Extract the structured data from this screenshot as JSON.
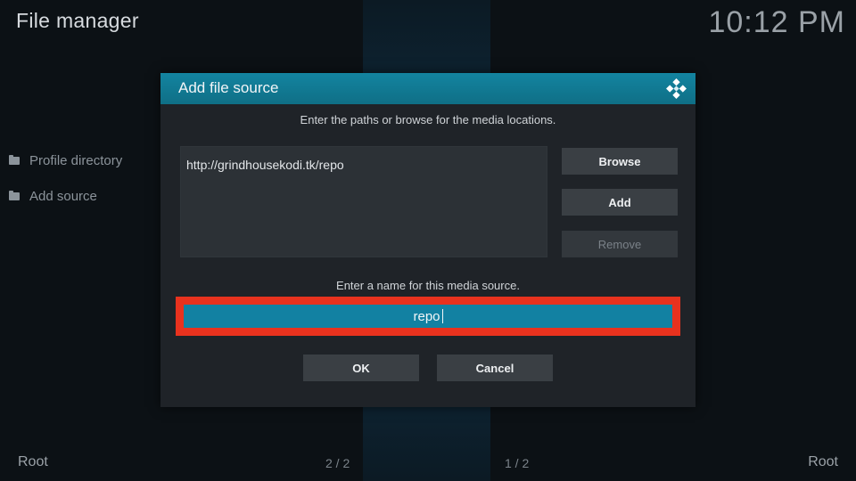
{
  "app": {
    "title": "File manager",
    "clock": "10:12 PM"
  },
  "sidebar": {
    "items": [
      {
        "label": "Profile directory",
        "icon": "folder-icon"
      },
      {
        "label": "Add source",
        "icon": "folder-icon"
      }
    ]
  },
  "footer": {
    "left": "Root",
    "right": "Root",
    "page_left": "2 / 2",
    "page_right": "1 / 2"
  },
  "dialog": {
    "title": "Add file source",
    "logo_icon": "kodi-logo-icon",
    "paths_instruction": "Enter the paths or browse for the media locations.",
    "paths": [
      "http://grindhousekodi.tk/repo"
    ],
    "buttons": {
      "browse": "Browse",
      "add": "Add",
      "remove": "Remove",
      "ok": "OK",
      "cancel": "Cancel"
    },
    "name_instruction": "Enter a name for this media source.",
    "name_value": "repo",
    "highlight_color": "#e8321e",
    "accent_color": "#1281a2"
  }
}
